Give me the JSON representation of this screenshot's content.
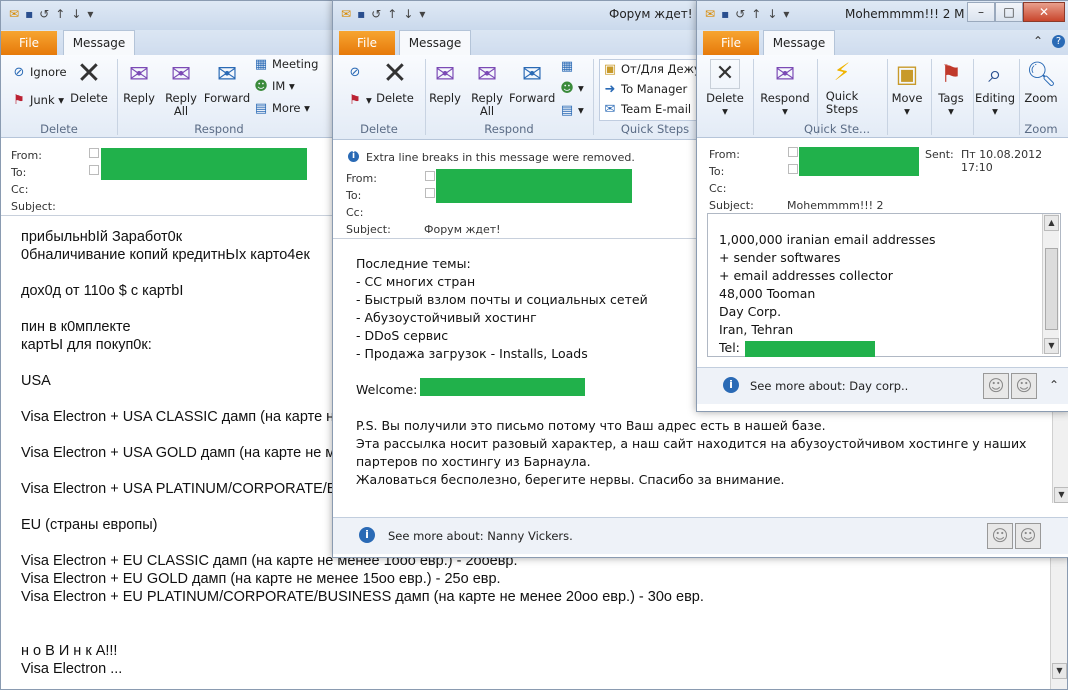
{
  "common": {
    "file_tab": "File",
    "message_tab": "Message",
    "delete": "Delete",
    "reply": "Reply",
    "reply_all": "Reply\nAll",
    "forward": "Forward",
    "group_delete": "Delete",
    "group_respond": "Respond",
    "group_quick_steps": "Quick Steps",
    "from_label": "From:",
    "to_label": "To:",
    "cc_label": "Cc:",
    "subject_label": "Subject:"
  },
  "win1": {
    "ignore": "Ignore",
    "junk": "Junk",
    "meeting": "Meeting",
    "im": "IM",
    "more": "More",
    "body": "прибыльнbIй Заработ0к\n0бналичивание копий кредитнЬIх карто4ек\n\nдох0д от 110о $ с картbI\n\nпин в к0мплекте\nкартЫ для покуп0к:\n\nUSA\n\nVisa Electron + USA CLASSIC дамп (на карте не менее 1ооо долл.) - 2оо дол.\n\nVisa Electron + USA GOLD дамп (на карте не менее 15оо долл.) - 25о дол.\n\nVisa Electron + USA PLATINUM/CORPORATE/BUSINESS дамп (на карте не менее 20оо долл.)\n\nEU (страны европы)\n\nVisa Electron + EU CLASSIC дамп (на карте не менее 1ооо евр.) - 2ооевр.\nVisa Electron + EU GOLD дамп (на карте не менее 15оо евр.) - 25о евр.\nVisa Electron + EU PLATINUM/CORPORATE/BUSINESS дамп (на карте не менее 20оо евр.) - 30о евр.\n\n\nн о В И н к А!!!\nVisa Electron ..."
  },
  "win2": {
    "title": "Форум ждет!",
    "qs_1": "От/Для Дежур",
    "qs_2": "To Manager",
    "qs_3": "Team E-mail",
    "info_bar": "Extra line breaks in this message were removed.",
    "subject": "Форум ждет!",
    "body_top": "Последние темы:\n- CC многих стран\n- Быстрый взлом почты и социальных сетей\n- Абузоустойчивый хостинг\n- DDoS сервис\n- Продажа загрузок - Installs, Loads",
    "welcome": "Welcome:",
    "body_bottom": "P.S. Вы получили это письмо потому что Ваш адрес есть в нашей базе.\nЭта рассылка носит разовый характер, а наш сайт находится на абузоустойчивом хостинге у наших\nпартеров по хостингу из Барнаула.\nЖаловаться бесполезно, берегите нервы. Спасибо за внимание.",
    "see_more": "See more about: Nanny Vickers."
  },
  "win3": {
    "title": "Mohemmmm!!! 2 M",
    "respond": "Respond",
    "quick_steps": "Quick\nSteps",
    "move": "Move",
    "tags": "Tags",
    "editing": "Editing",
    "zoom": "Zoom",
    "group_quick_steps": "Quick Ste...",
    "group_zoom": "Zoom",
    "sent_label": "Sent:",
    "sent_value": "Пт 10.08.2012 17:10",
    "subject": "Mohemmmm!!! 2",
    "body": "1,000,000 iranian email addresses\n+ sender softwares\n+ email addresses collector\n48,000 Tooman\nDay Corp.\nIran, Tehran",
    "tel_label": "Tel:",
    "see_more": "See more about: Day corp.."
  }
}
